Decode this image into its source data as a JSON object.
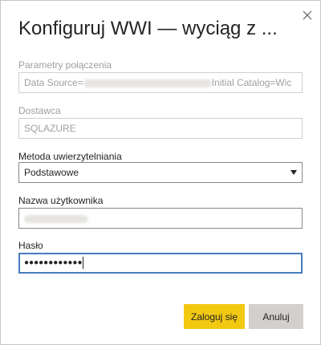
{
  "dialog": {
    "title": "Konfiguruj WWI — wyciąg z ...",
    "close_icon": "close-icon"
  },
  "fields": {
    "connection": {
      "label": "Parametry połączenia",
      "value_prefix": "Data Source=",
      "value_suffix": "Initial Catalog=Wic"
    },
    "provider": {
      "label": "Dostawca",
      "value": "SQLAZURE"
    },
    "auth_method": {
      "label": "Metoda uwierzytelniania",
      "value": "Podstawowe"
    },
    "username": {
      "label": "Nazwa użytkownika"
    },
    "password": {
      "label": "Hasło",
      "value": "●●●●●●●●●●●●"
    }
  },
  "buttons": {
    "sign_in": "Zaloguj się",
    "cancel": "Anuluj"
  },
  "colors": {
    "primary": "#f2c811",
    "secondary": "#d2d0ce",
    "focus": "#4a7bbd"
  }
}
